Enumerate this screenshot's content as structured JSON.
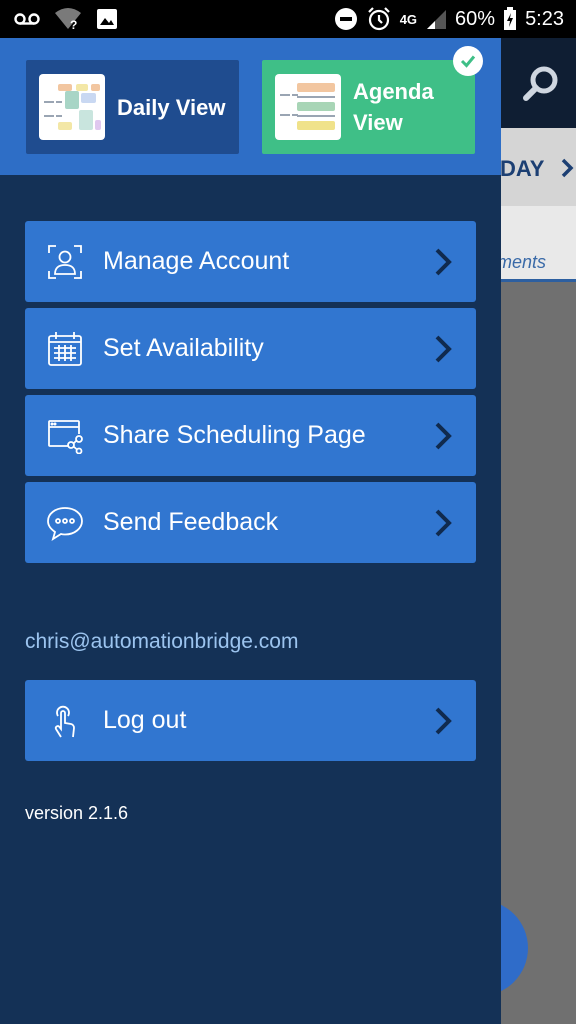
{
  "status_bar": {
    "icons": [
      "voicemail-icon",
      "wifi-unknown-icon",
      "image-icon",
      "dnd-icon",
      "alarm-icon",
      "4g-icon",
      "signal-icon",
      "battery-icon"
    ],
    "network": "4G",
    "battery": "60%",
    "time": "5:23"
  },
  "background": {
    "today_label": "DAY",
    "tab_label": "tments",
    "header_color": "#0f1e33"
  },
  "drawer": {
    "views": [
      {
        "label": "Daily View",
        "selected": false,
        "color": "#1f4c8f"
      },
      {
        "label": "Agenda View",
        "selected": true,
        "color": "#3fbf87"
      }
    ],
    "menu": [
      {
        "label": "Manage Account",
        "icon": "account-icon"
      },
      {
        "label": "Set Availability",
        "icon": "calendar-icon"
      },
      {
        "label": "Share Scheduling Page",
        "icon": "share-page-icon"
      },
      {
        "label": "Send Feedback",
        "icon": "chat-bubble-icon"
      }
    ],
    "email": "chris@automationbridge.com",
    "logout_label": "Log out",
    "version": "version 2.1.6",
    "accent": "#3176d0",
    "background": "#143156"
  }
}
